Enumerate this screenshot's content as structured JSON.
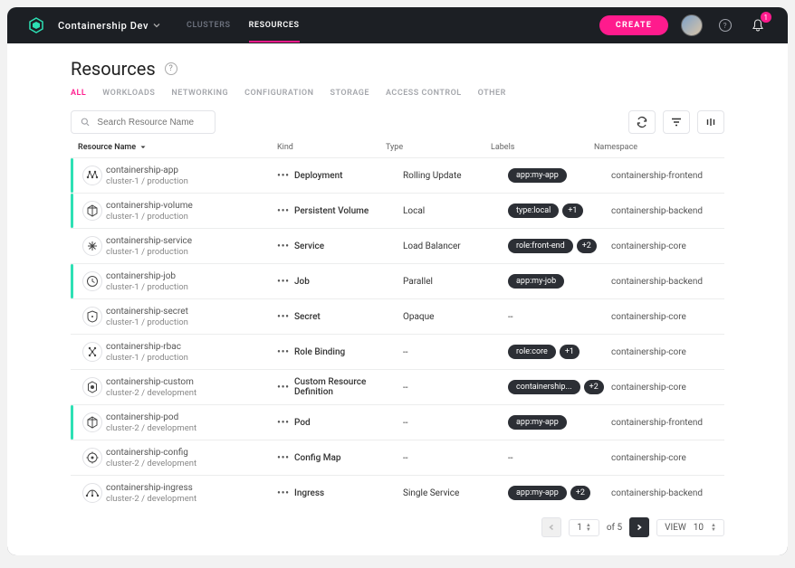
{
  "header": {
    "org": "Containership Dev",
    "nav": {
      "clusters": "CLUSTERS",
      "resources": "RESOURCES"
    },
    "create": "CREATE",
    "notifications_count": "1"
  },
  "page": {
    "title": "Resources"
  },
  "tabs": {
    "all": "ALL",
    "workloads": "WORKLOADS",
    "networking": "NETWORKING",
    "configuration": "CONFIGURATION",
    "storage": "STORAGE",
    "access_control": "ACCESS CONTROL",
    "other": "OTHER"
  },
  "search": {
    "placeholder": "Search Resource Name"
  },
  "columns": {
    "name": "Resource Name",
    "kind": "Kind",
    "type": "Type",
    "labels": "Labels",
    "namespace": "Namespace"
  },
  "rows": [
    {
      "indicator": "green",
      "name": "containership-app",
      "cluster": "cluster-1 / production",
      "kind": "Deployment",
      "type": "Rolling Update",
      "label": "app:my-app",
      "extra": "",
      "ns": "containership-frontend"
    },
    {
      "indicator": "green",
      "name": "containership-volume",
      "cluster": "cluster-1 / production",
      "kind": "Persistent Volume",
      "type": "Local",
      "label": "type:local",
      "extra": "+1",
      "ns": "containership-backend"
    },
    {
      "indicator": "",
      "name": "containership-service",
      "cluster": "cluster-1 / production",
      "kind": "Service",
      "type": "Load Balancer",
      "label": "role:front-end",
      "extra": "+2",
      "ns": "containership-core"
    },
    {
      "indicator": "green",
      "name": "containership-job",
      "cluster": "cluster-1 / production",
      "kind": "Job",
      "type": "Parallel",
      "label": "app:my-job",
      "extra": "",
      "ns": "containership-backend"
    },
    {
      "indicator": "",
      "name": "containership-secret",
      "cluster": "cluster-1 / production",
      "kind": "Secret",
      "type": "Opaque",
      "label": "--",
      "extra": "",
      "ns": "containership-core"
    },
    {
      "indicator": "",
      "name": "containership-rbac",
      "cluster": "cluster-1 / production",
      "kind": "Role Binding",
      "type": "--",
      "label": "role:core",
      "extra": "+1",
      "ns": "containership-core"
    },
    {
      "indicator": "",
      "name": "containership-custom",
      "cluster": "cluster-2 / development",
      "kind": "Custom Resource Definition",
      "type": "--",
      "label": "containership...",
      "extra": "+2",
      "ns": "containership-core"
    },
    {
      "indicator": "green",
      "name": "containership-pod",
      "cluster": "cluster-2 / development",
      "kind": "Pod",
      "type": "--",
      "label": "app:my-app",
      "extra": "",
      "ns": "containership-frontend"
    },
    {
      "indicator": "",
      "name": "containership-config",
      "cluster": "cluster-2 / development",
      "kind": "Config Map",
      "type": "--",
      "label": "--",
      "extra": "",
      "ns": "containership-core"
    },
    {
      "indicator": "",
      "name": "containership-ingress",
      "cluster": "cluster-2 / development",
      "kind": "Ingress",
      "type": "Single Service",
      "label": "app:my-app",
      "extra": "+2",
      "ns": "containership-backend"
    }
  ],
  "row_icons": [
    "deployment",
    "cube",
    "service",
    "clock",
    "secret",
    "rbac",
    "crd",
    "cube",
    "config",
    "ingress"
  ],
  "pager": {
    "page": "1",
    "of_label": "of",
    "total": "5",
    "view_label": "VIEW",
    "view_count": "10"
  }
}
